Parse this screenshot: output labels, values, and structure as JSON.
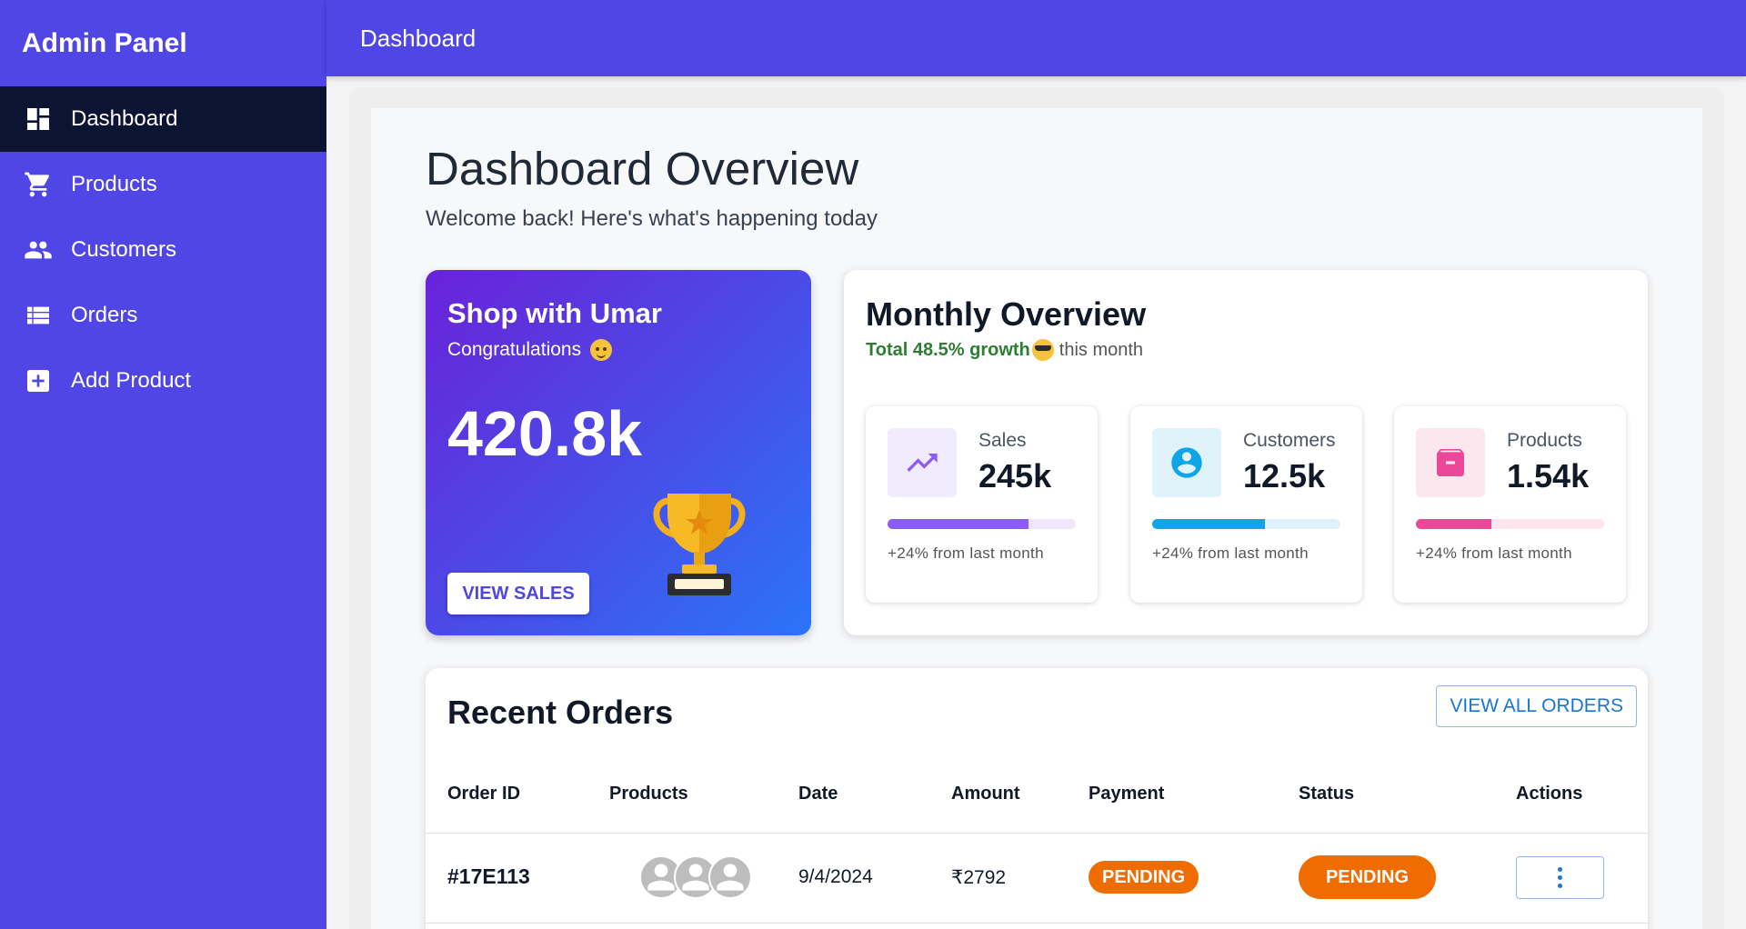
{
  "sidebar": {
    "brand": "Admin Panel",
    "items": [
      {
        "label": "Dashboard",
        "icon": "dashboard-icon",
        "active": true
      },
      {
        "label": "Products",
        "icon": "cart-icon",
        "active": false
      },
      {
        "label": "Customers",
        "icon": "people-icon",
        "active": false
      },
      {
        "label": "Orders",
        "icon": "list-icon",
        "active": false
      },
      {
        "label": "Add Product",
        "icon": "add-box-icon",
        "active": false
      }
    ]
  },
  "header": {
    "title": "Dashboard"
  },
  "page": {
    "title": "Dashboard Overview",
    "subtitle": "Welcome back! Here's what's happening today"
  },
  "promo": {
    "title": "Shop with Umar",
    "subtitle": "Congratulations",
    "value": "420.8k",
    "button": "VIEW SALES",
    "icon": "trophy-icon"
  },
  "monthly": {
    "title": "Monthly Overview",
    "growth_strong": "Total 48.5% growth",
    "growth_rest": "this month",
    "stats": [
      {
        "label": "Sales",
        "value": "245k",
        "note": "+24% from last month",
        "progress": 0.75,
        "color": "#8b5cf6",
        "track": "#efe7fd",
        "icon_bg": "#f1ecfd",
        "icon": "trending-up-icon"
      },
      {
        "label": "Customers",
        "value": "12.5k",
        "note": "+24% from last month",
        "progress": 0.6,
        "color": "#0ea5e9",
        "track": "#dff2fb",
        "icon_bg": "#e0f3fb",
        "icon": "account-circle-icon"
      },
      {
        "label": "Products",
        "value": "1.54k",
        "note": "+24% from last month",
        "progress": 0.4,
        "color": "#ec4899",
        "track": "#fde4ef",
        "icon_bg": "#fde7ef",
        "icon": "archive-box-icon"
      }
    ]
  },
  "orders": {
    "title": "Recent Orders",
    "view_all": "VIEW ALL ORDERS",
    "columns": [
      "Order ID",
      "Products",
      "Date",
      "Amount",
      "Payment",
      "Status",
      "Actions"
    ],
    "rows": [
      {
        "id": "#17E113",
        "date": "9/4/2024",
        "amount": "₹2792",
        "payment": "PENDING",
        "status": "PENDING"
      }
    ]
  },
  "colors": {
    "brand": "#5046e5",
    "active_nav": "#0c1434",
    "pending": "#ef6c00",
    "growth": "#2e7d32"
  }
}
